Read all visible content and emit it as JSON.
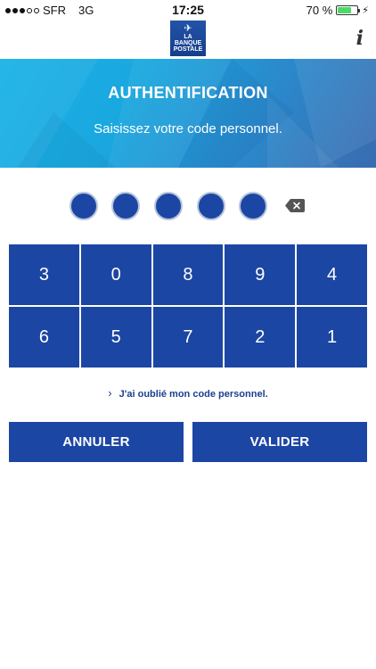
{
  "status_bar": {
    "carrier": "SFR",
    "network": "3G",
    "time": "17:25",
    "battery_percent": "70 %",
    "battery_level": 0.7,
    "signal_strength": 3
  },
  "navbar": {
    "logo_text_line1": "LA",
    "logo_text_line2": "BANQUE",
    "logo_text_line3": "POSTALE",
    "info_icon": "info-icon"
  },
  "banner": {
    "title": "AUTHENTIFICATION",
    "subtitle": "Saisissez votre code personnel."
  },
  "pin": {
    "slots": 5,
    "filled": 5,
    "backspace_icon": "backspace-icon"
  },
  "keypad": {
    "keys": [
      "3",
      "0",
      "8",
      "9",
      "4",
      "6",
      "5",
      "7",
      "2",
      "1"
    ]
  },
  "forgot_link": {
    "label": "J'ai oublié mon code personnel."
  },
  "actions": {
    "cancel_label": "ANNULER",
    "validate_label": "VALIDER"
  },
  "colors": {
    "primary": "#1c46a3",
    "banner_start": "#18b2e6",
    "banner_end": "#3a6bb0"
  }
}
